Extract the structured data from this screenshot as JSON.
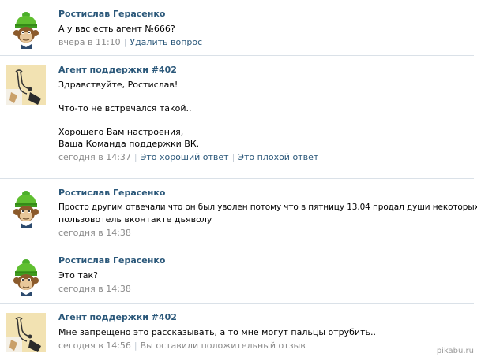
{
  "messages": [
    {
      "avatar": "monkey-green-hat-avatar",
      "author": "Ростислав Герасенко",
      "lines": [
        "А у вас есть агент №666?"
      ],
      "time": "вчера в 11:10",
      "actions": [
        "Удалить вопрос"
      ]
    },
    {
      "avatar": "support-agent-avatar",
      "author": "Агент поддержки #402",
      "lines": [
        "Здравствуйте, Ростислав!",
        "",
        "Что-то не встречался такой..",
        "",
        "Хорошего Вам настроения,",
        "Ваша Команда поддержки ВК."
      ],
      "time": "сегодня в 14:37",
      "actions": [
        "Это хороший ответ",
        "Это плохой ответ"
      ]
    },
    {
      "avatar": "monkey-green-hat-avatar",
      "author": "Ростислав Герасенко",
      "lines": [
        "Просто другим отвечали что он был уволен потому что в пятницу 13.04 продал души некоторых",
        "пользовотель вконтакте дьяволу"
      ],
      "time": "сегодня в 14:38",
      "actions": []
    },
    {
      "avatar": "monkey-green-hat-avatar",
      "author": "Ростислав Герасенко",
      "lines": [
        "Это так?"
      ],
      "time": "сегодня в 14:38",
      "actions": []
    },
    {
      "avatar": "support-agent-avatar",
      "author": "Агент поддержки #402",
      "lines": [
        "Мне запрещено это рассказывать, а то мне могут пальцы отрубить.."
      ],
      "time": "сегодня в 14:56",
      "actions": [],
      "status": "Вы оставили положительный отзыв"
    }
  ],
  "watermark": "pikabu.ru",
  "colors": {
    "author": "#2b587a",
    "meta": "#8a8a8a",
    "divider": "#dae1e8"
  }
}
